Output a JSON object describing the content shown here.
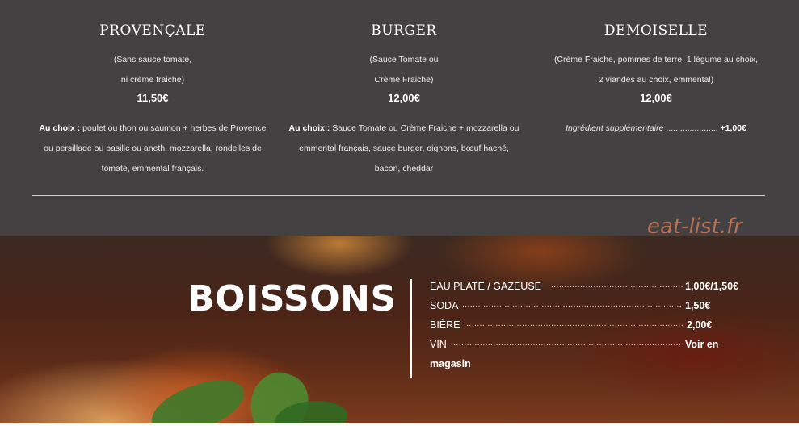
{
  "menu": {
    "items": [
      {
        "title": "PROVENÇALE",
        "sub_line1": "(Sans sauce tomate,",
        "sub_line2": "ni crème fraiche)",
        "price": "11,50€",
        "choice_label": "Au choix :",
        "desc_line1": " poulet ou thon ou saumon + herbes de Provence",
        "desc_line2": "ou persillade ou basilic ou aneth, mozzarella, rondelles de",
        "desc_line3": "tomate, emmental français."
      },
      {
        "title": "BURGER",
        "sub_line1": "(Sauce Tomate ou",
        "sub_line2": "Crème Fraiche)",
        "price": "12,00€",
        "choice_label": "Au choix :",
        "desc_line1": " Sauce Tomate ou Crème Fraiche + mozzarella ou",
        "desc_line2": "emmental français, sauce burger, oignons, bœuf haché,",
        "desc_line3": "bacon, cheddar"
      },
      {
        "title": "DEMOISELLE",
        "sub_line1": "(Crème Fraiche, pommes de terre, 1 légume au choix,",
        "sub_line2": "2 viandes au choix, emmental)",
        "price": "12,00€",
        "extra_label": "Ingrédient supplémentaire",
        "extra_dots": " ...................... ",
        "extra_price": "+1,00€"
      }
    ]
  },
  "watermark": "eat-list.fr",
  "drinks": {
    "heading": "BOISSONS",
    "items": [
      {
        "name": "EAU PLATE / GAZEUSE",
        "price": "1,00€/1,50€"
      },
      {
        "name": "SODA",
        "price": "1,50€"
      },
      {
        "name": "BIÈRE",
        "price": "2,00€"
      },
      {
        "name": "VIN",
        "price": "Voir en"
      }
    ],
    "wine_continued": "magasin"
  },
  "colors": {
    "top_background": "#434142",
    "watermark": "#d07a5a"
  }
}
